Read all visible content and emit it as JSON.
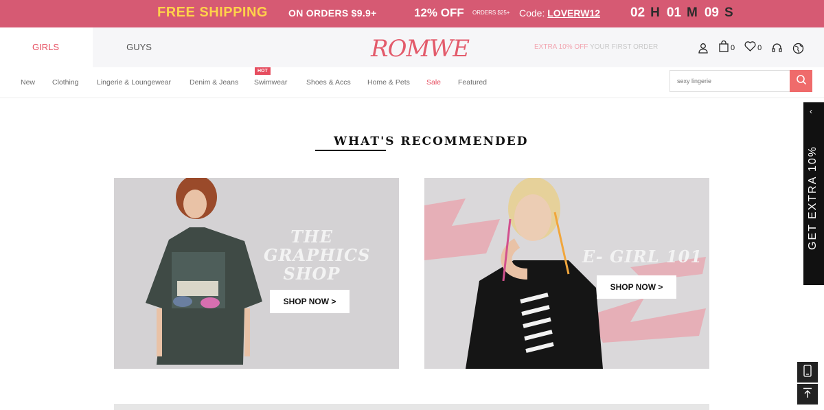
{
  "promo": {
    "free_shipping": "FREE SHIPPING",
    "on_orders": "ON ORDERS $9.9+",
    "percent_off": "12% OFF",
    "orders_min": "ORDERS $25+",
    "code_label": "Code:",
    "code_value": "LOVERW12",
    "timer": {
      "hours": "02",
      "h": "H",
      "minutes": "01",
      "m": "M",
      "seconds": "09",
      "s": "S"
    }
  },
  "header": {
    "tab_girls": "GIRLS",
    "tab_guys": "GUYS",
    "logo": "ROMWE",
    "extra_offer_hl": "EXTRA 10% OFF",
    "extra_offer_rest": " YOUR FIRST ORDER",
    "cart_count": "0",
    "wishlist_count": "0"
  },
  "nav": {
    "items": [
      "New",
      "Clothing",
      "Lingerie & Loungewear",
      "Denim & Jeans",
      "Swimwear",
      "Shoes & Accs",
      "Home & Pets",
      "Sale",
      "Featured"
    ],
    "hot_badge": "HOT"
  },
  "search": {
    "placeholder": "sexy lingerie"
  },
  "section": {
    "title": "WHAT'S RECOMMENDED"
  },
  "banners": [
    {
      "title_line1": "THE",
      "title_line2": "GRAPHICS",
      "title_line3": "SHOP",
      "button": "SHOP NOW >"
    },
    {
      "title": "E- GIRL 101",
      "button": "SHOP NOW >"
    }
  ],
  "rail": {
    "label": "GET EXTRA 10%"
  },
  "colors": {
    "promo_bg": "#d65a73",
    "accent": "#e64d5f",
    "promo_highlight": "#ffd24a"
  }
}
